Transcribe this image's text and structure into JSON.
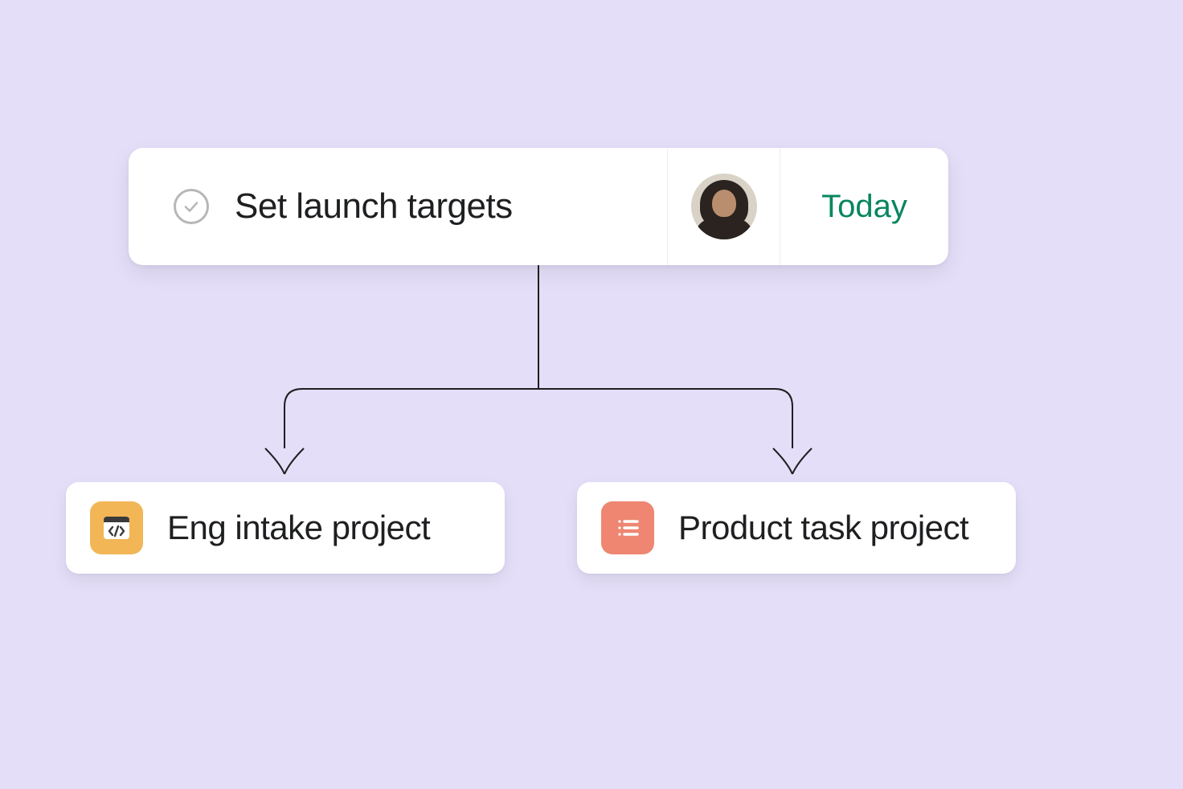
{
  "task": {
    "title": "Set launch targets",
    "due_label": "Today",
    "due_color": "#098560"
  },
  "projects": {
    "left": {
      "title": "Eng intake project",
      "icon": "code-window-icon",
      "icon_color": "amber"
    },
    "right": {
      "title": "Product task project",
      "icon": "list-icon",
      "icon_color": "salmon"
    }
  }
}
